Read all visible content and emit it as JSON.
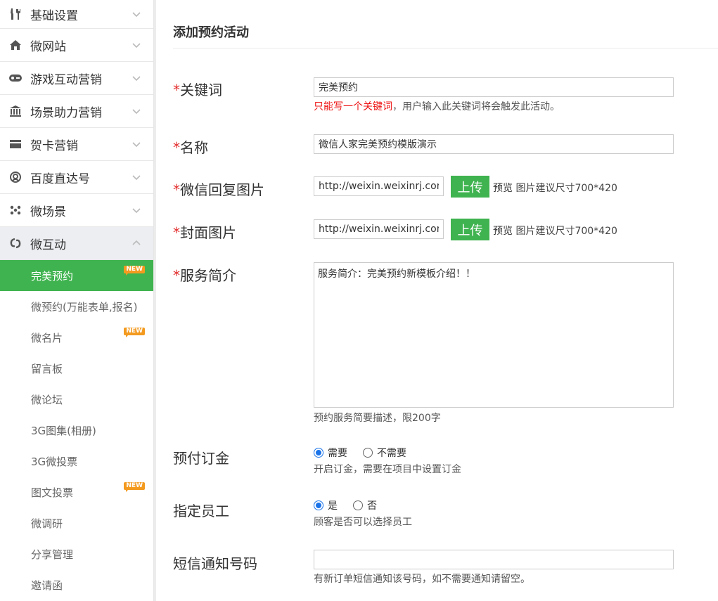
{
  "sidebar": {
    "menu": [
      {
        "label": "基础设置",
        "icon": "tools-icon"
      },
      {
        "label": "微网站",
        "icon": "home-icon"
      },
      {
        "label": "游戏互动营销",
        "icon": "gamepad-icon"
      },
      {
        "label": "场景助力营销",
        "icon": "bank-icon"
      },
      {
        "label": "贺卡营销",
        "icon": "card-icon"
      },
      {
        "label": "百度直达号",
        "icon": "target-icon"
      },
      {
        "label": "微场景",
        "icon": "dots-icon"
      },
      {
        "label": "微互动",
        "icon": "swirl-icon"
      }
    ],
    "submenu": [
      {
        "label": "完美预约",
        "badge": "NEW"
      },
      {
        "label": "微预约(万能表单,报名)"
      },
      {
        "label": "微名片",
        "badge": "NEW"
      },
      {
        "label": "留言板"
      },
      {
        "label": "微论坛"
      },
      {
        "label": "3G图集(相册)"
      },
      {
        "label": "3G微投票"
      },
      {
        "label": "图文投票",
        "badge": "NEW"
      },
      {
        "label": "微调研"
      },
      {
        "label": "分享管理"
      },
      {
        "label": "邀请函"
      }
    ]
  },
  "page": {
    "title": "添加预约活动"
  },
  "form": {
    "keyword": {
      "required_mark": "*",
      "label": "关键词",
      "value": "完美预约",
      "hint_red": "只能写一个关键词",
      "hint_rest": "，用户输入此关键词将会触发此活动。"
    },
    "name": {
      "required_mark": "*",
      "label": "名称",
      "value": "微信人家完美预约模版演示"
    },
    "reply_image": {
      "required_mark": "*",
      "label": "微信回复图片",
      "value": "http://weixin.weixinrj.com",
      "upload": "上传",
      "preview": "预览",
      "size_hint": "图片建议尺寸700*420"
    },
    "cover_image": {
      "required_mark": "*",
      "label": "封面图片",
      "value": "http://weixin.weixinrj.com",
      "upload": "上传",
      "preview": "预览",
      "size_hint": "图片建议尺寸700*420"
    },
    "service_intro": {
      "required_mark": "*",
      "label": "服务简介",
      "value": "服务简介：完美预约新模板介绍！！",
      "hint": "预约服务简要描述，限200字"
    },
    "deposit": {
      "label": "预付订金",
      "option_yes": "需要",
      "option_no": "不需要",
      "hint": "开启订金，需要在项目中设置订金"
    },
    "staff": {
      "label": "指定员工",
      "option_yes": "是",
      "option_no": "否",
      "hint": "顾客是否可以选择员工"
    },
    "sms": {
      "label": "短信通知号码",
      "value": "",
      "hint": "有新订单短信通知该号码，如不需要通知请留空。"
    }
  }
}
